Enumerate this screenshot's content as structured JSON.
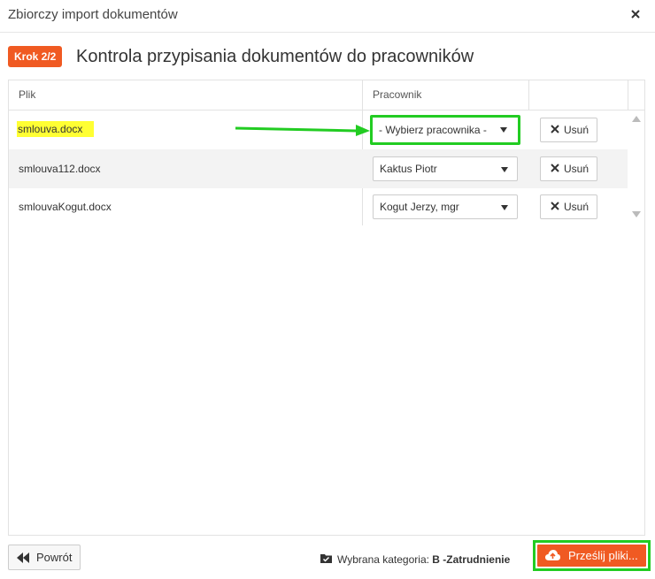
{
  "dialog": {
    "title": "Zbiorczy import dokumentów",
    "close_icon": "close-icon"
  },
  "step": {
    "badge": "Krok 2/2",
    "title": "Kontrola przypisania dokumentów do pracowników"
  },
  "table": {
    "headers": {
      "file": "Plik",
      "employee": "Pracownik",
      "actions": ""
    },
    "rows": [
      {
        "file": "smlouva.docx",
        "employee": "- Wybierz pracownika -",
        "delete_label": "Usuń"
      },
      {
        "file": "smlouva112.docx",
        "employee": "Kaktus Piotr",
        "delete_label": "Usuń"
      },
      {
        "file": "smlouvaKogut.docx",
        "employee": "Kogut Jerzy, mgr",
        "delete_label": "Usuń"
      }
    ]
  },
  "footer": {
    "back_label": "Powrót",
    "category_label": "Wybrana kategoria: ",
    "category_value": "B -Zatrudnienie",
    "send_label": "Prześlij pliki..."
  },
  "colors": {
    "accent": "#f05a22",
    "highlight_green": "#22cc22",
    "file_highlight": "#ffff33"
  }
}
